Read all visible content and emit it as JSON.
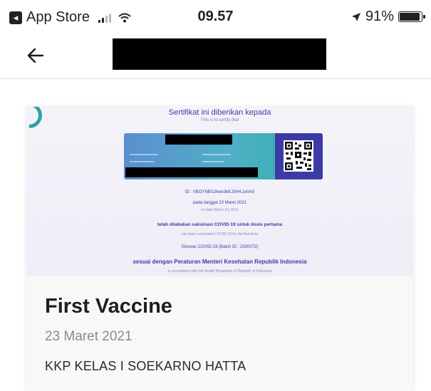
{
  "status_bar": {
    "back_app": "App Store",
    "time": "09.57",
    "battery": "91%",
    "battery_level": 0.91
  },
  "header": {
    "back_icon": "arrow-left-icon"
  },
  "certificate": {
    "heading": "Sertifikat ini diberikan kepada",
    "subheading": "This is to certify that",
    "id_line": "ID : VBOYNBSJhwe3kKJ3H4.1e0A0",
    "date_line": "pada tanggal 23 Maret 2021",
    "date_line_en": "on date March 23, 2021",
    "vaccinated_line": "telah dilakukan vaksinasi COVID-19 untuk dosis pertama",
    "vaccinated_line_en": "has been vaccinated COVID-19 for the first dose",
    "vaccine_name": "Sinovac COVID-19 (Batch ID : 2020072)",
    "regulation_line": "sesuai dengan Peraturan Menteri Kesehatan Republik Indonesia",
    "regulation_line_en": "in accordance with the Health Regulation of Republic of Indonesia"
  },
  "card": {
    "title": "First Vaccine",
    "date": "23 Maret 2021",
    "location": "KKP KELAS I SOEKARNO HATTA"
  }
}
